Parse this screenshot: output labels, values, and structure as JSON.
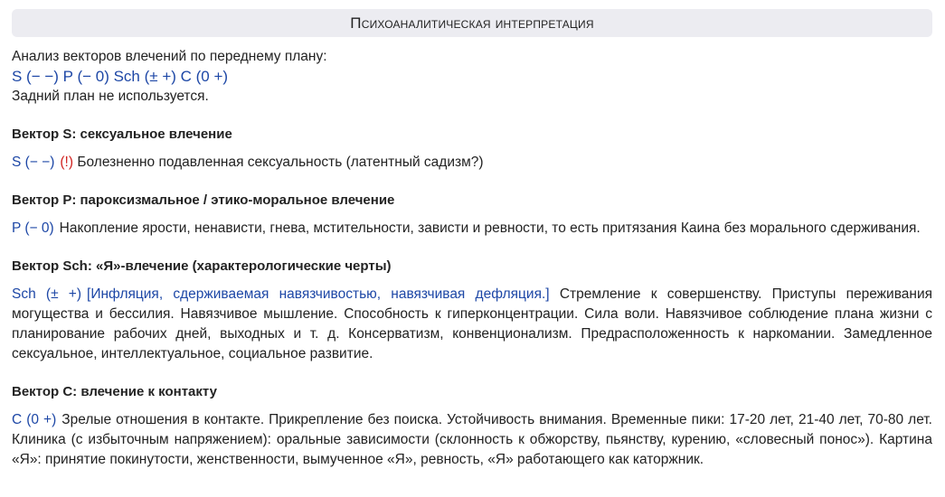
{
  "header": {
    "title": "Психоаналитическая интерпретация"
  },
  "intro": {
    "line1": "Анализ векторов влечений по переднему плану:",
    "formula": "S (− −) P (− 0) Sch (± +) C (0 +)",
    "line3": "Задний план не используется."
  },
  "sections": [
    {
      "title": "Вектор S: сексуальное влечение",
      "code": "S (− −)",
      "warning": "(!)",
      "bracket": "",
      "text": "Болезненно подавленная сексуальность (латентный садизм?)"
    },
    {
      "title": "Вектор P: пароксизмальное / этико-моральное влечение",
      "code": "P (− 0)",
      "warning": "",
      "bracket": "",
      "text": "Накопление ярости, ненависти, гнева, мстительности, зависти и ревности, то есть притязания Каина без морального сдерживания."
    },
    {
      "title": "Вектор Sch: «Я»-влечение (характерологические черты)",
      "code": "Sch (± +)",
      "warning": "",
      "bracket": "[Инфляция, сдерживаемая навязчивостью, навязчивая дефляция.]",
      "text": "Стремление к совершенству. Приступы переживания могущества и бессилия. Навязчивое мышление. Способность к гиперконцентрации. Сила воли. Навязчивое соблюдение плана жизни с планирование рабочих дней, выходных и т. д. Консерватизм, конвенционализм. Предрасположенность к наркомании. Замедленное сексуальное, интеллектуальное, социальное развитие."
    },
    {
      "title": "Вектор C: влечение к контакту",
      "code": "C (0 +)",
      "warning": "",
      "bracket": "",
      "text": "Зрелые отношения в контакте. Прикрепление без поиска. Устойчивость внимания. Временные пики: 17-20 лет, 21-40 лет, 70-80 лет. Клиника (с избыточным напряжением): оральные зависимости (склонность к обжорству, пьянству, курению, «словесный понос»). Картина «Я»: принятие покинутости, женственности, вымученное «Я», ревность, «Я» работающего как каторжник."
    }
  ],
  "colors": {
    "accent_blue": "#1d47a6",
    "warning_red": "#d0221f",
    "header_bg": "#ececf1"
  }
}
